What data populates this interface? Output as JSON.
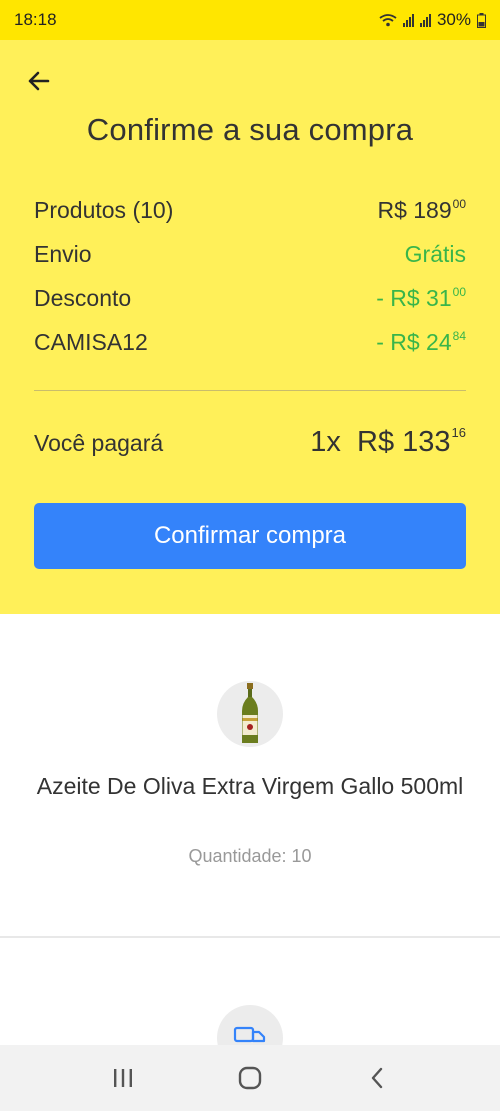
{
  "status_bar": {
    "time": "18:18",
    "battery": "30%"
  },
  "header": {
    "title": "Confirme a sua compra"
  },
  "summary": {
    "rows": [
      {
        "label": "Produtos (10)",
        "value": "R$ 189",
        "cents": "00",
        "color": "#333333"
      },
      {
        "label": "Envio",
        "value": "Grátis",
        "cents": "",
        "color": "#39b54a"
      },
      {
        "label": "Desconto",
        "value": "- R$ 31",
        "cents": "00",
        "color": "#39b54a"
      },
      {
        "label": "CAMISA12",
        "value": "- R$ 24",
        "cents": "84",
        "color": "#39b54a"
      }
    ],
    "total_label": "Você pagará",
    "total_value": "1x  R$ 133",
    "total_cents": "16"
  },
  "actions": {
    "confirm_label": "Confirmar compra"
  },
  "product": {
    "name": "Azeite De Oliva Extra Virgem Gallo 500ml",
    "quantity": "Quantidade: 10"
  },
  "colors": {
    "header_bg": "#fff059",
    "status_bg": "#ffe600",
    "accent": "#3483fa",
    "green": "#39b54a"
  },
  "icons": {
    "back": "arrow-left-icon",
    "product": "olive-oil-bottle-icon",
    "shipping": "truck-icon",
    "nav_recent": "recent-apps-icon",
    "nav_home": "home-icon",
    "nav_back": "nav-back-icon"
  }
}
